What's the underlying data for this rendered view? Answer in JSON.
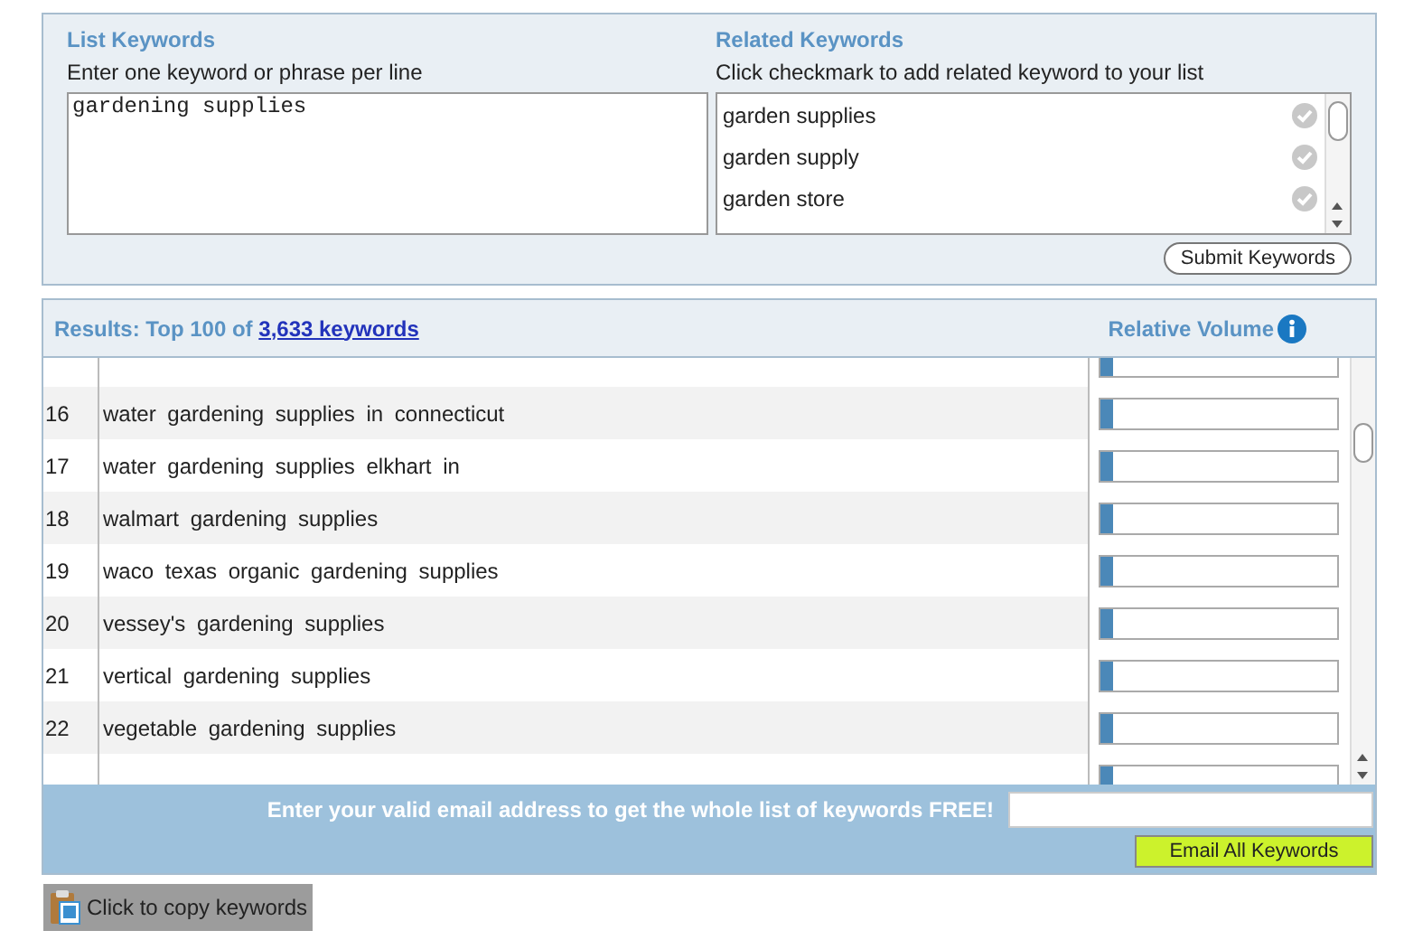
{
  "list_keywords": {
    "title": "List Keywords",
    "hint": "Enter one keyword or phrase per line",
    "value": "gardening supplies"
  },
  "related_keywords": {
    "title": "Related Keywords",
    "hint": "Click checkmark to add related keyword to your list",
    "items": [
      {
        "label": "garden supplies"
      },
      {
        "label": "garden supply"
      },
      {
        "label": "garden store"
      }
    ],
    "submit": "Submit Keywords"
  },
  "results": {
    "prefix": "Results: Top 100 of",
    "link": "3,633 keywords",
    "volume_header": "Relative Volume",
    "rows": [
      {
        "level": 0.05
      },
      {
        "number": "16",
        "keyword": "water gardening supplies in connecticut",
        "level": 0.05
      },
      {
        "number": "17",
        "keyword": "water gardening supplies elkhart in",
        "level": 0.05
      },
      {
        "number": "18",
        "keyword": "walmart gardening supplies",
        "level": 0.05
      },
      {
        "number": "19",
        "keyword": "waco texas organic gardening supplies",
        "level": 0.05
      },
      {
        "number": "20",
        "keyword": "vessey's gardening supplies",
        "level": 0.05
      },
      {
        "number": "21",
        "keyword": "vertical gardening supplies",
        "level": 0.05
      },
      {
        "number": "22",
        "keyword": "vegetable gardening supplies",
        "level": 0.05
      },
      {
        "level": 0.05
      }
    ]
  },
  "email": {
    "prompt": "Enter your valid email address to get the whole list of keywords FREE!",
    "button": "Email All Keywords"
  },
  "copy_button": "Click to copy keywords"
}
